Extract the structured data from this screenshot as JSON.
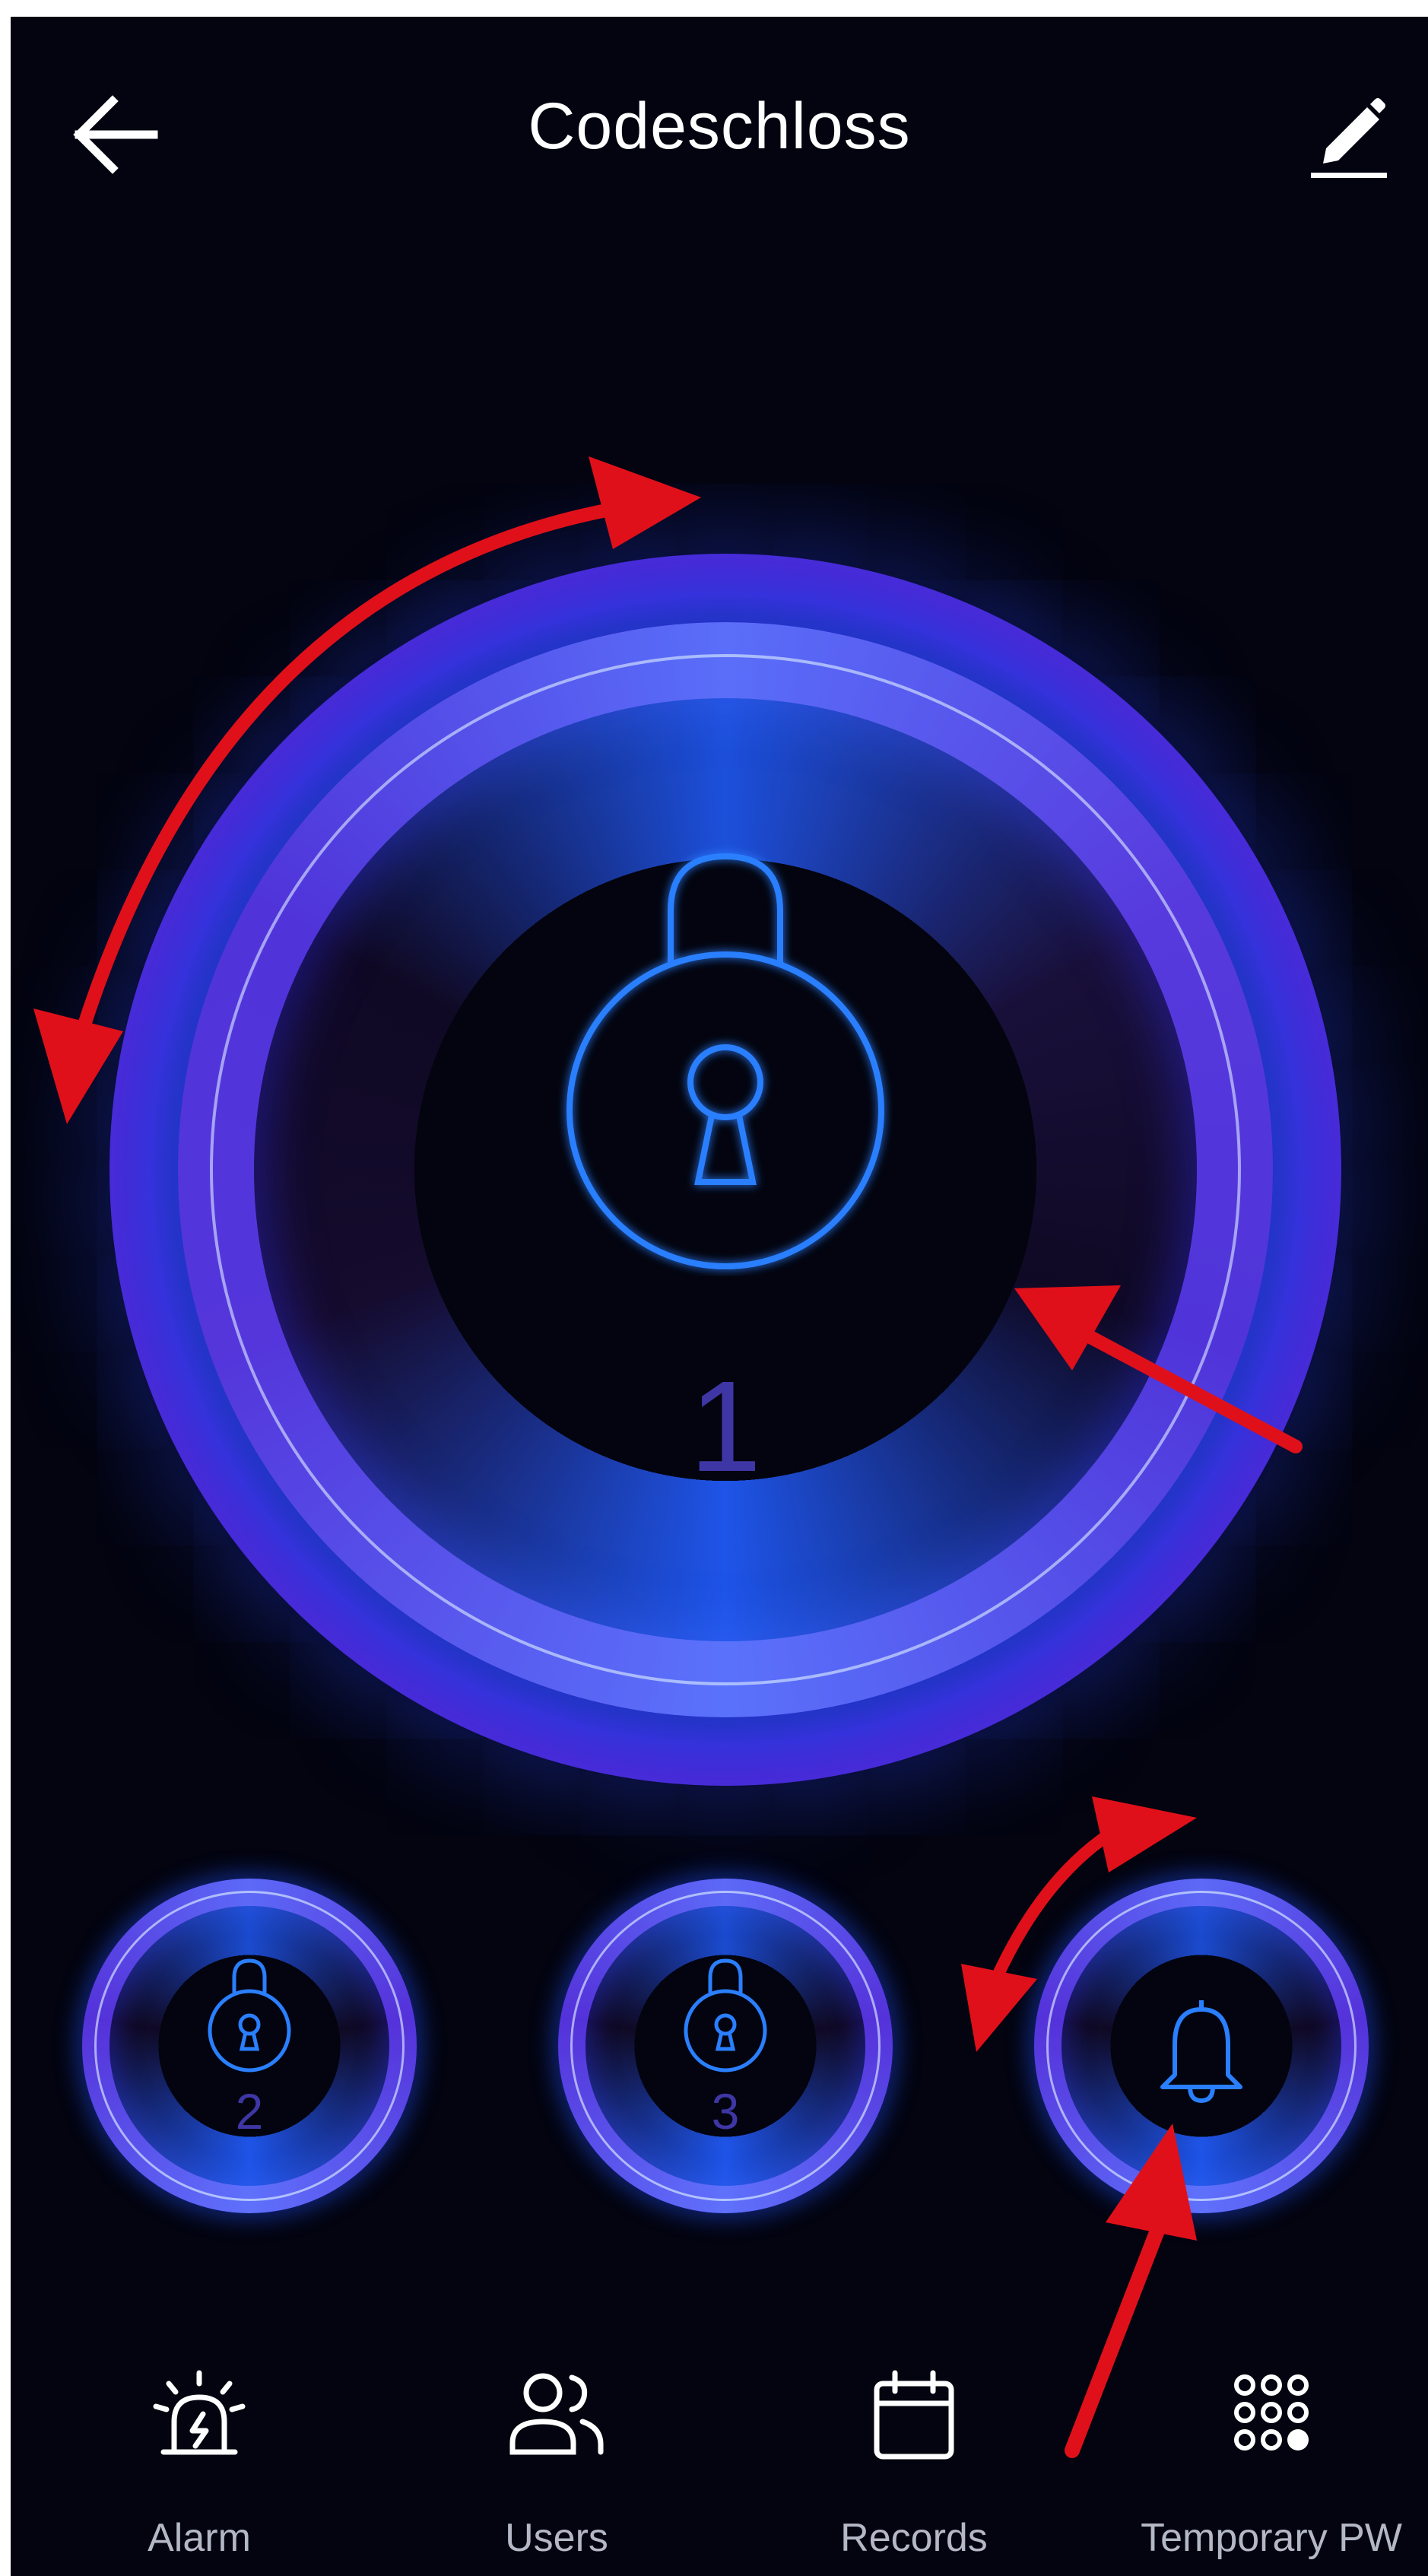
{
  "header": {
    "title": "Codeschloss",
    "back_icon": "arrow-left-icon",
    "edit_icon": "pencil-icon"
  },
  "main_lock": {
    "number": "1",
    "icon": "padlock-icon"
  },
  "small_dials": [
    {
      "number": "2",
      "icon": "padlock-icon"
    },
    {
      "number": "3",
      "icon": "padlock-icon"
    },
    {
      "number": "",
      "icon": "bell-icon"
    }
  ],
  "nav": {
    "items": [
      {
        "label": "Alarm",
        "icon": "siren-icon"
      },
      {
        "label": "Users",
        "icon": "users-icon"
      },
      {
        "label": "Records",
        "icon": "calendar-icon"
      },
      {
        "label": "Temporary PW",
        "icon": "keypad-dots-icon"
      }
    ]
  },
  "colors": {
    "background": "#03040f",
    "ring_purple": "#4c2ed6",
    "ring_blue": "#1e48f0",
    "icon_blue": "#2a7fff",
    "number_text": "#3f36a6",
    "nav_text": "#b4b8c6",
    "annotation_red": "#e0101a"
  }
}
